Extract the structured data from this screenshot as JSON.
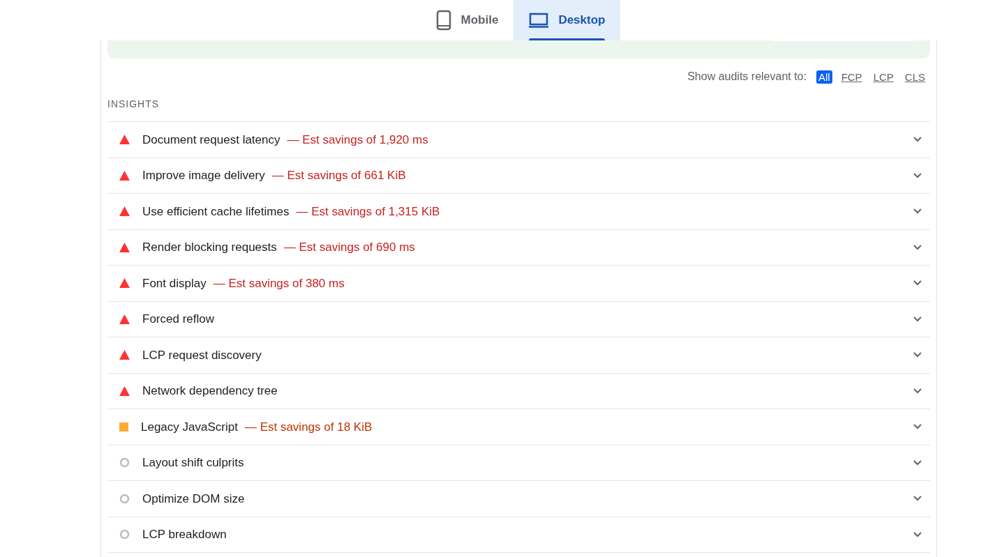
{
  "device_tabs": [
    {
      "label": "Mobile",
      "kind": "mobile",
      "selected": false
    },
    {
      "label": "Desktop",
      "kind": "desktop",
      "selected": true
    }
  ],
  "filter": {
    "label": "Show audits relevant to:",
    "options": [
      {
        "label": "All",
        "selected": true
      },
      {
        "label": "FCP",
        "selected": false
      },
      {
        "label": "LCP",
        "selected": false
      },
      {
        "label": "CLS",
        "selected": false
      }
    ]
  },
  "section_title": "INSIGHTS",
  "audits": [
    {
      "title": "Document request latency",
      "savings": "— Est savings of 1,920 ms",
      "kind": "fail"
    },
    {
      "title": "Improve image delivery",
      "savings": "— Est savings of 661 KiB",
      "kind": "fail"
    },
    {
      "title": "Use efficient cache lifetimes",
      "savings": "— Est savings of 1,315 KiB",
      "kind": "fail"
    },
    {
      "title": "Render blocking requests",
      "savings": "— Est savings of 690 ms",
      "kind": "fail"
    },
    {
      "title": "Font display",
      "savings": "— Est savings of 380 ms",
      "kind": "fail"
    },
    {
      "title": "Forced reflow",
      "kind": "fail"
    },
    {
      "title": "LCP request discovery",
      "kind": "fail"
    },
    {
      "title": "Network dependency tree",
      "kind": "fail"
    },
    {
      "title": "Legacy JavaScript",
      "savings": "— Est savings of 18 KiB",
      "kind": "average"
    },
    {
      "title": "Layout shift culprits",
      "kind": "informative"
    },
    {
      "title": "Optimize DOM size",
      "kind": "informative"
    },
    {
      "title": "LCP breakdown",
      "kind": "informative"
    }
  ]
}
